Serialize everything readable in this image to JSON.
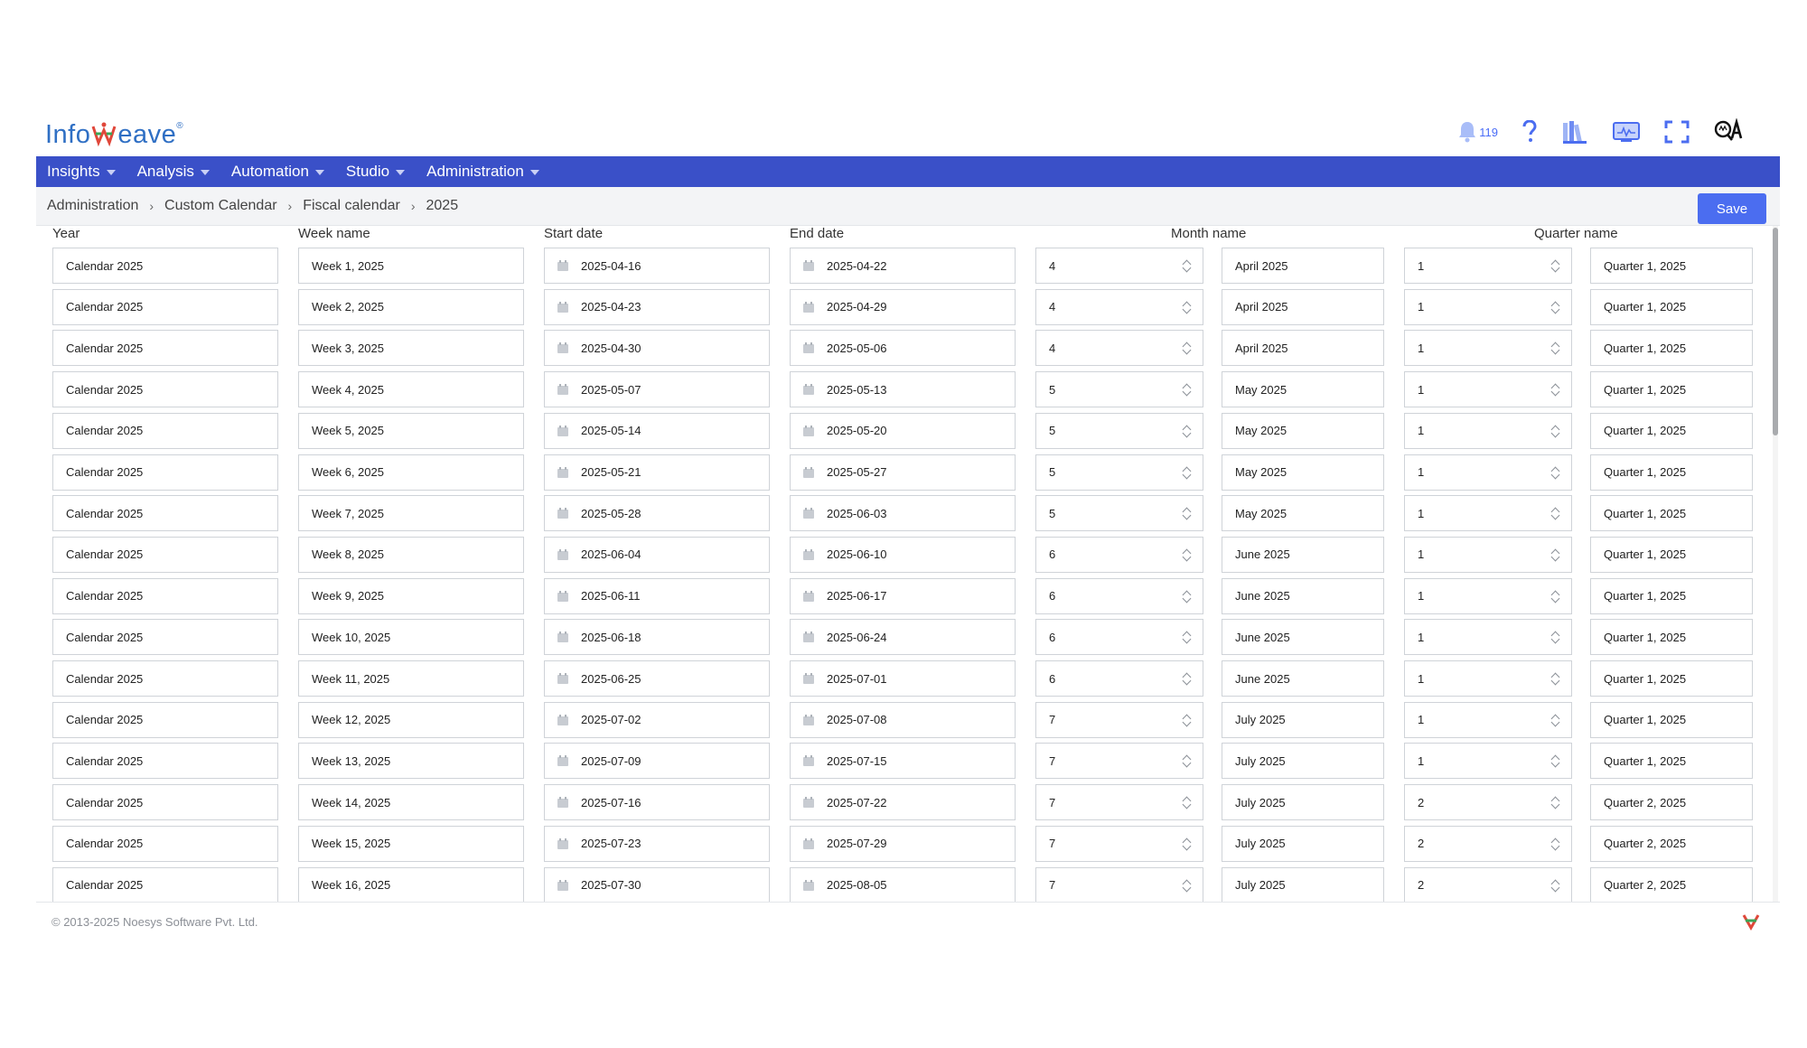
{
  "header": {
    "logo_text_left": "Info",
    "logo_text_right": "eave",
    "logo_tm": "®",
    "notification_count": "119",
    "icons": [
      "bell-icon",
      "help-icon",
      "library-icon",
      "monitor-icon",
      "fullscreen-icon",
      "qa-icon"
    ]
  },
  "nav": {
    "items": [
      "Insights",
      "Analysis",
      "Automation",
      "Studio",
      "Administration"
    ]
  },
  "breadcrumb": {
    "items": [
      "Administration",
      "Custom Calendar",
      "Fiscal calendar",
      "2025"
    ]
  },
  "toolbar": {
    "save_label": "Save"
  },
  "columns": {
    "year": "Year",
    "week_name": "Week name",
    "start_date": "Start date",
    "end_date": "End date",
    "month_name": "Month name",
    "quarter_name": "Quarter name"
  },
  "rows": [
    {
      "year": "Calendar 2025",
      "week": "Week 1, 2025",
      "start": "2025-04-16",
      "end": "2025-04-22",
      "month_no": "4",
      "month": "April 2025",
      "quarter_no": "1",
      "quarter": "Quarter 1, 2025"
    },
    {
      "year": "Calendar 2025",
      "week": "Week 2, 2025",
      "start": "2025-04-23",
      "end": "2025-04-29",
      "month_no": "4",
      "month": "April 2025",
      "quarter_no": "1",
      "quarter": "Quarter 1, 2025"
    },
    {
      "year": "Calendar 2025",
      "week": "Week 3, 2025",
      "start": "2025-04-30",
      "end": "2025-05-06",
      "month_no": "4",
      "month": "April 2025",
      "quarter_no": "1",
      "quarter": "Quarter 1, 2025"
    },
    {
      "year": "Calendar 2025",
      "week": "Week 4, 2025",
      "start": "2025-05-07",
      "end": "2025-05-13",
      "month_no": "5",
      "month": "May 2025",
      "quarter_no": "1",
      "quarter": "Quarter 1, 2025"
    },
    {
      "year": "Calendar 2025",
      "week": "Week 5, 2025",
      "start": "2025-05-14",
      "end": "2025-05-20",
      "month_no": "5",
      "month": "May 2025",
      "quarter_no": "1",
      "quarter": "Quarter 1, 2025"
    },
    {
      "year": "Calendar 2025",
      "week": "Week 6, 2025",
      "start": "2025-05-21",
      "end": "2025-05-27",
      "month_no": "5",
      "month": "May 2025",
      "quarter_no": "1",
      "quarter": "Quarter 1, 2025"
    },
    {
      "year": "Calendar 2025",
      "week": "Week 7, 2025",
      "start": "2025-05-28",
      "end": "2025-06-03",
      "month_no": "5",
      "month": "May 2025",
      "quarter_no": "1",
      "quarter": "Quarter 1, 2025"
    },
    {
      "year": "Calendar 2025",
      "week": "Week 8, 2025",
      "start": "2025-06-04",
      "end": "2025-06-10",
      "month_no": "6",
      "month": "June 2025",
      "quarter_no": "1",
      "quarter": "Quarter 1, 2025"
    },
    {
      "year": "Calendar 2025",
      "week": "Week 9, 2025",
      "start": "2025-06-11",
      "end": "2025-06-17",
      "month_no": "6",
      "month": "June 2025",
      "quarter_no": "1",
      "quarter": "Quarter 1, 2025"
    },
    {
      "year": "Calendar 2025",
      "week": "Week 10, 2025",
      "start": "2025-06-18",
      "end": "2025-06-24",
      "month_no": "6",
      "month": "June 2025",
      "quarter_no": "1",
      "quarter": "Quarter 1, 2025"
    },
    {
      "year": "Calendar 2025",
      "week": "Week 11, 2025",
      "start": "2025-06-25",
      "end": "2025-07-01",
      "month_no": "6",
      "month": "June 2025",
      "quarter_no": "1",
      "quarter": "Quarter 1, 2025"
    },
    {
      "year": "Calendar 2025",
      "week": "Week 12, 2025",
      "start": "2025-07-02",
      "end": "2025-07-08",
      "month_no": "7",
      "month": "July 2025",
      "quarter_no": "1",
      "quarter": "Quarter 1, 2025"
    },
    {
      "year": "Calendar 2025",
      "week": "Week 13, 2025",
      "start": "2025-07-09",
      "end": "2025-07-15",
      "month_no": "7",
      "month": "July 2025",
      "quarter_no": "1",
      "quarter": "Quarter 1, 2025"
    },
    {
      "year": "Calendar 2025",
      "week": "Week 14, 2025",
      "start": "2025-07-16",
      "end": "2025-07-22",
      "month_no": "7",
      "month": "July 2025",
      "quarter_no": "2",
      "quarter": "Quarter 2, 2025"
    },
    {
      "year": "Calendar 2025",
      "week": "Week 15, 2025",
      "start": "2025-07-23",
      "end": "2025-07-29",
      "month_no": "7",
      "month": "July 2025",
      "quarter_no": "2",
      "quarter": "Quarter 2, 2025"
    },
    {
      "year": "Calendar 2025",
      "week": "Week 16, 2025",
      "start": "2025-07-30",
      "end": "2025-08-05",
      "month_no": "7",
      "month": "July 2025",
      "quarter_no": "2",
      "quarter": "Quarter 2, 2025"
    }
  ],
  "footer": {
    "copyright": "© 2013-2025 Noesys Software Pvt. Ltd."
  },
  "colors": {
    "nav_bg": "#3a50c8",
    "accent": "#4b6df0",
    "logo_blue": "#2f6fc4",
    "logo_red": "#e0473a",
    "logo_green": "#3aa655"
  }
}
